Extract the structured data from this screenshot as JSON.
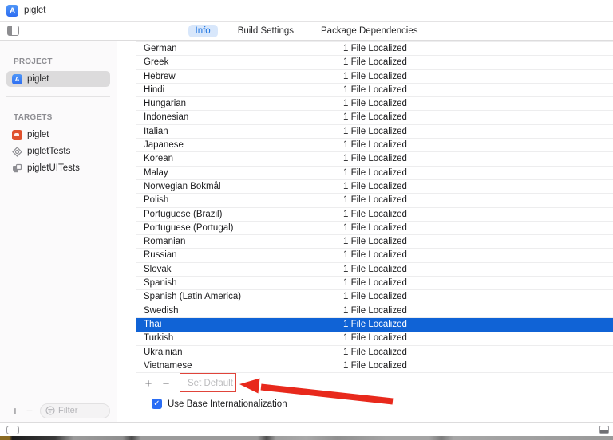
{
  "window": {
    "title": "piglet"
  },
  "tabs": {
    "items": [
      {
        "label": "Info",
        "selected": true
      },
      {
        "label": "Build Settings",
        "selected": false
      },
      {
        "label": "Package Dependencies",
        "selected": false
      }
    ]
  },
  "sidebar": {
    "project_header": "PROJECT",
    "project_item": {
      "label": "piglet",
      "selected": true
    },
    "targets_header": "TARGETS",
    "targets": [
      {
        "label": "piglet",
        "icon": "app-target-icon"
      },
      {
        "label": "pigletTests",
        "icon": "unit-test-target-icon"
      },
      {
        "label": "pigletUITests",
        "icon": "ui-test-target-icon"
      }
    ],
    "add_label": "+",
    "remove_label": "−",
    "filter_placeholder": "Filter"
  },
  "localizations": {
    "rows": [
      {
        "language": "German",
        "files": "1 File Localized",
        "selected": false
      },
      {
        "language": "Greek",
        "files": "1 File Localized",
        "selected": false
      },
      {
        "language": "Hebrew",
        "files": "1 File Localized",
        "selected": false
      },
      {
        "language": "Hindi",
        "files": "1 File Localized",
        "selected": false
      },
      {
        "language": "Hungarian",
        "files": "1 File Localized",
        "selected": false
      },
      {
        "language": "Indonesian",
        "files": "1 File Localized",
        "selected": false
      },
      {
        "language": "Italian",
        "files": "1 File Localized",
        "selected": false
      },
      {
        "language": "Japanese",
        "files": "1 File Localized",
        "selected": false
      },
      {
        "language": "Korean",
        "files": "1 File Localized",
        "selected": false
      },
      {
        "language": "Malay",
        "files": "1 File Localized",
        "selected": false
      },
      {
        "language": "Norwegian Bokmål",
        "files": "1 File Localized",
        "selected": false
      },
      {
        "language": "Polish",
        "files": "1 File Localized",
        "selected": false
      },
      {
        "language": "Portuguese (Brazil)",
        "files": "1 File Localized",
        "selected": false
      },
      {
        "language": "Portuguese (Portugal)",
        "files": "1 File Localized",
        "selected": false
      },
      {
        "language": "Romanian",
        "files": "1 File Localized",
        "selected": false
      },
      {
        "language": "Russian",
        "files": "1 File Localized",
        "selected": false
      },
      {
        "language": "Slovak",
        "files": "1 File Localized",
        "selected": false
      },
      {
        "language": "Spanish",
        "files": "1 File Localized",
        "selected": false
      },
      {
        "language": "Spanish (Latin America)",
        "files": "1 File Localized",
        "selected": false
      },
      {
        "language": "Swedish",
        "files": "1 File Localized",
        "selected": false
      },
      {
        "language": "Thai",
        "files": "1 File Localized",
        "selected": true
      },
      {
        "language": "Turkish",
        "files": "1 File Localized",
        "selected": false
      },
      {
        "language": "Ukrainian",
        "files": "1 File Localized",
        "selected": false
      },
      {
        "language": "Vietnamese",
        "files": "1 File Localized",
        "selected": false
      }
    ]
  },
  "footer": {
    "add_label": "+",
    "remove_label": "−",
    "set_default_label": "Set Default",
    "use_base_label": "Use Base Internationalization",
    "use_base_checked": "✓"
  },
  "colors": {
    "selection_blue": "#1063d6",
    "tab_selected_bg": "#d8e7fb",
    "tab_selected_text": "#1a73e2",
    "annotation_red": "#e8291c",
    "checkbox_blue": "#2a6df4"
  }
}
